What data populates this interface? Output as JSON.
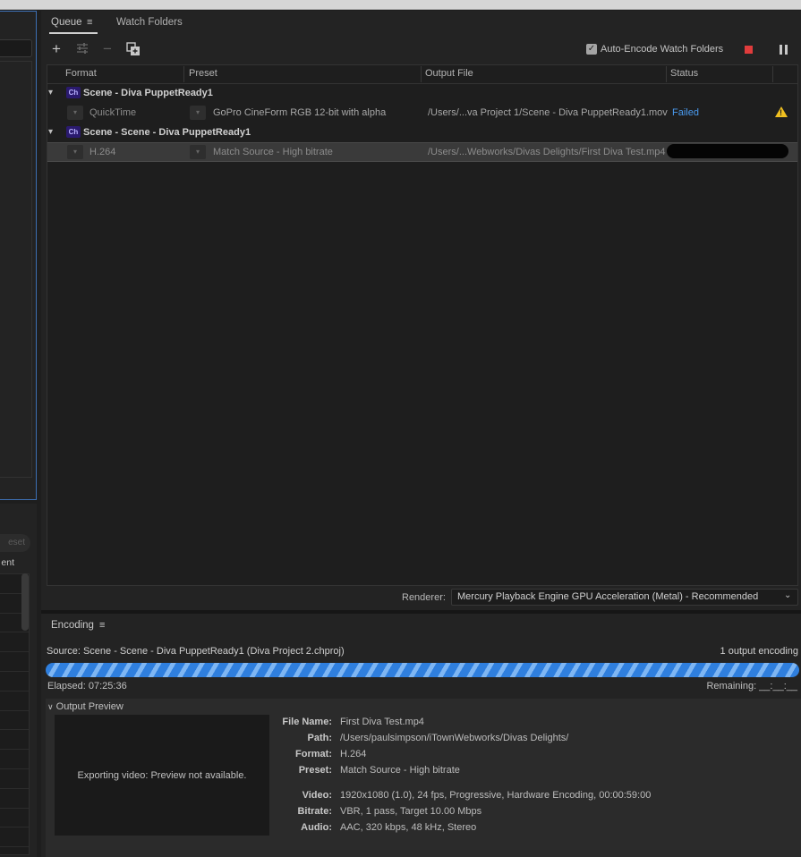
{
  "left_panel": {
    "button_partial": "eset",
    "label_partial": "ent"
  },
  "queue": {
    "tabs": [
      {
        "label": "Queue",
        "menu": "≡"
      },
      {
        "label": "Watch Folders"
      }
    ],
    "toolbar": {
      "add_icon": "plus-icon",
      "settings_icon": "sliders-icon",
      "remove_icon": "minus-icon",
      "duplicate_icon": "duplicate-icon",
      "auto_encode_label": "Auto-Encode Watch Folders",
      "auto_encode_checked": true,
      "stop_color": "#e03c3c"
    },
    "columns": [
      "Format",
      "Preset",
      "Output File",
      "Status"
    ],
    "groups": [
      {
        "badge": "Ch",
        "name": "Scene - Diva PuppetReady1",
        "items": [
          {
            "format": "QuickTime",
            "preset": "GoPro CineForm RGB 12-bit with alpha",
            "output": "/Users/...va Project 1/Scene - Diva PuppetReady1.mov",
            "status": "Failed",
            "warning": true
          }
        ]
      },
      {
        "badge": "Ch",
        "name": "Scene - Scene - Diva PuppetReady1",
        "items": [
          {
            "format": "H.264",
            "preset": "Match Source - High bitrate",
            "output": "/Users/...Webworks/Divas Delights/First Diva Test.mp4",
            "status": "",
            "warning": false
          }
        ]
      }
    ],
    "renderer_label": "Renderer:",
    "renderer_value": "Mercury Playback Engine GPU Acceleration (Metal) - Recommended"
  },
  "encoding": {
    "title": "Encoding",
    "menu": "≡",
    "source": "Source: Scene - Scene - Diva PuppetReady1 (Diva Project 2.chproj)",
    "output_count": "1 output encoding",
    "elapsed": "Elapsed: 07:25:36",
    "remaining": "Remaining: __:__:__",
    "progress_color": "#2f7fde",
    "output_preview_label": "Output Preview",
    "preview_message": "Exporting video: Preview not available.",
    "meta": [
      {
        "key": "File Name:",
        "value": "First Diva Test.mp4"
      },
      {
        "key": "Path:",
        "value": "/Users/paulsimpson/iTownWebworks/Divas Delights/"
      },
      {
        "key": "Format:",
        "value": "H.264"
      },
      {
        "key": "Preset:",
        "value": "Match Source - High bitrate"
      },
      {
        "key": "Video:",
        "value": "1920x1080 (1.0), 24 fps, Progressive, Hardware Encoding, 00:00:59:00"
      },
      {
        "key": "Bitrate:",
        "value": "VBR, 1 pass, Target 10.00 Mbps"
      },
      {
        "key": "Audio:",
        "value": "AAC, 320 kbps, 48 kHz, Stereo"
      }
    ]
  }
}
